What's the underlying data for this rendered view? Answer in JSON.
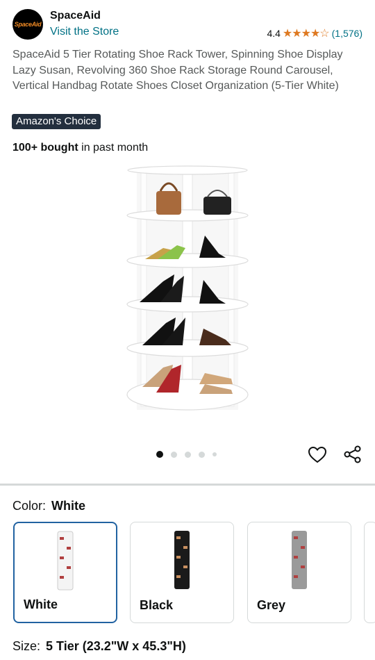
{
  "header": {
    "logo_text": "SpaceAid",
    "brand": "SpaceAid",
    "visit_store": "Visit the Store",
    "rating": "4.4",
    "rating_stars": 4.4,
    "review_count": "(1,576)"
  },
  "product": {
    "title": "SpaceAid 5 Tier Rotating Shoe Rack Tower, Spinning Shoe Display Lazy Susan, Revolving 360 Shoe Rack Storage Round Carousel, Vertical Handbag Rotate Shoes Closet Organization (5-Tier White)",
    "badge": "Amazon's Choice",
    "bought_bold": "100+ bought",
    "bought_rest": " in past month"
  },
  "gallery": {
    "total_images": 5,
    "active_index": 0
  },
  "icons": {
    "favorite": "heart-icon",
    "share": "share-icon"
  },
  "color": {
    "label": "Color:",
    "selected": "White",
    "options": [
      {
        "name": "White",
        "swatch": "#f2f2f2"
      },
      {
        "name": "Black",
        "swatch": "#1a1a1a"
      },
      {
        "name": "Grey",
        "swatch": "#9a9a9a"
      }
    ]
  },
  "size": {
    "label": "Size:",
    "selected": "5 Tier (23.2\"W x 45.3\"H)"
  },
  "colors": {
    "link": "#007185",
    "star": "#de7921",
    "badge_bg": "#232f3e",
    "selected_border": "#2162a1"
  }
}
